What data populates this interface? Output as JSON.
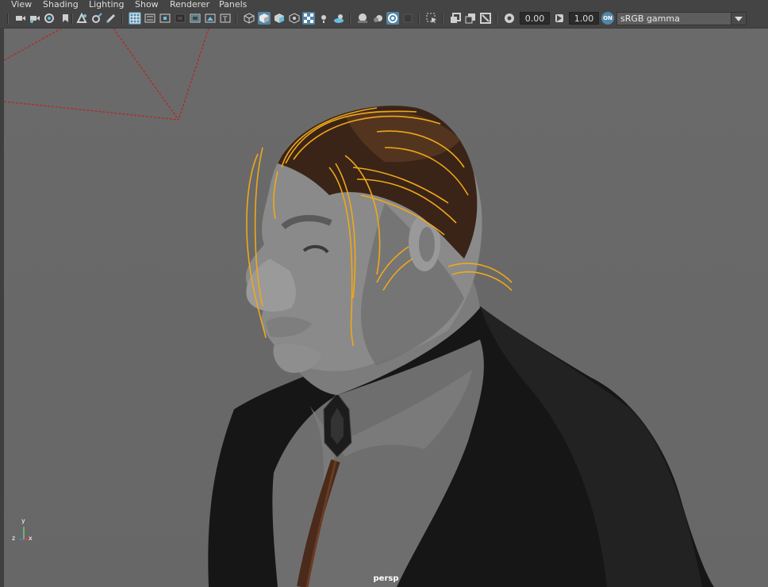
{
  "menu": {
    "items": [
      "View",
      "Shading",
      "Lighting",
      "Show",
      "Renderer",
      "Panels"
    ]
  },
  "toolbar": {
    "icons": [
      "select-camera-icon",
      "camera-attributes-icon",
      "bookmarks-icon",
      "image-plane-icon",
      "2d-pan-zoom-icon",
      "grease-pencil-icon",
      "grid-icon",
      "film-gate-icon",
      "resolution-gate-icon",
      "gate-mask-icon",
      "field-chart-icon",
      "safe-action-icon",
      "safe-title-icon",
      "wireframe-icon",
      "smooth-shade-icon",
      "default-material-icon",
      "textured-icon",
      "use-lights-icon",
      "shadows-icon",
      "ambient-occlusion-icon",
      "motion-blur-icon",
      "anti-aliasing-icon",
      "depth-of-field-icon",
      "isolate-select-icon",
      "xray-icon",
      "xray-joints-icon",
      "backface-culling-icon",
      "exposure-icon",
      "gamma-icon",
      "color-management-icon"
    ],
    "exposure_value": "0.00",
    "gamma_value": "1.00",
    "color_management_toggle": "ON",
    "view_transform": "sRGB gamma"
  },
  "viewport": {
    "camera_name": "persp",
    "axis_labels": {
      "y": "y",
      "x": "x",
      "z": "z"
    }
  },
  "colors": {
    "accent_active": "#5285a6",
    "selection_hair": "#f0a818",
    "camera_frustum": "#c02020"
  }
}
